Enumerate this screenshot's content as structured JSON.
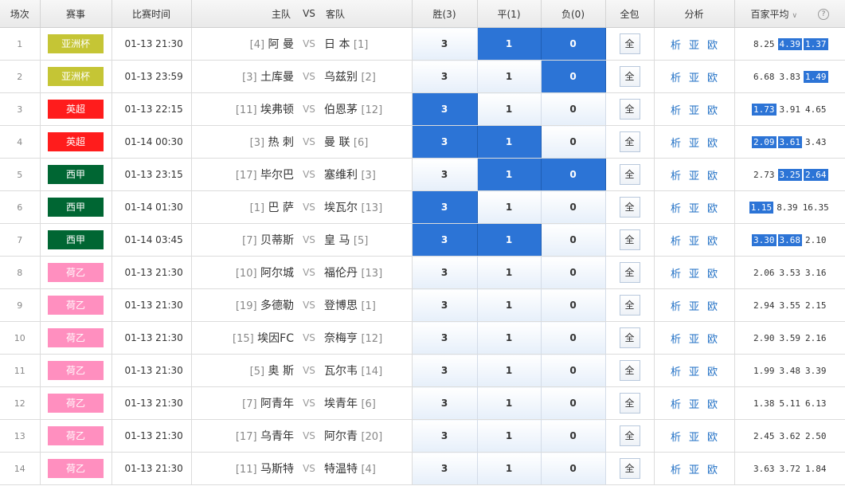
{
  "header": {
    "no": "场次",
    "league": "赛事",
    "time": "比赛时间",
    "home": "主队",
    "vs": "VS",
    "away": "客队",
    "win": "胜(3)",
    "draw": "平(1)",
    "lose": "负(0)",
    "allpack": "全包",
    "analysis": "分析",
    "avg": "百家平均"
  },
  "colors": {
    "亚洲杯": "#c5c535",
    "英超": "#ff1c1c",
    "西甲": "#006633",
    "荷乙": "#ff8fbf"
  },
  "rows": [
    {
      "no": "1",
      "league": "亚洲杯",
      "time": "01-13 21:30",
      "home_rank": "[4]",
      "home": "阿 曼",
      "vs": "VS",
      "away": "日 本",
      "away_rank": "[1]",
      "w": "3",
      "d": "1",
      "l": "0",
      "sel": [
        false,
        true,
        true
      ],
      "all": "全",
      "a1": "析",
      "a2": "亚",
      "a3": "欧",
      "odds": [
        "8.25",
        "4.39",
        "1.37"
      ],
      "hl": [
        false,
        true,
        true
      ]
    },
    {
      "no": "2",
      "league": "亚洲杯",
      "time": "01-13 23:59",
      "home_rank": "[3]",
      "home": "土库曼",
      "vs": "VS",
      "away": "乌兹别",
      "away_rank": "[2]",
      "w": "3",
      "d": "1",
      "l": "0",
      "sel": [
        false,
        false,
        true
      ],
      "all": "全",
      "a1": "析",
      "a2": "亚",
      "a3": "欧",
      "odds": [
        "6.68",
        "3.83",
        "1.49"
      ],
      "hl": [
        false,
        false,
        true
      ]
    },
    {
      "no": "3",
      "league": "英超",
      "time": "01-13 22:15",
      "home_rank": "[11]",
      "home": "埃弗顿",
      "vs": "VS",
      "away": "伯恩茅",
      "away_rank": "[12]",
      "w": "3",
      "d": "1",
      "l": "0",
      "sel": [
        true,
        false,
        false
      ],
      "all": "全",
      "a1": "析",
      "a2": "亚",
      "a3": "欧",
      "odds": [
        "1.73",
        "3.91",
        "4.65"
      ],
      "hl": [
        true,
        false,
        false
      ]
    },
    {
      "no": "4",
      "league": "英超",
      "time": "01-14 00:30",
      "home_rank": "[3]",
      "home": "热 刺",
      "vs": "VS",
      "away": "曼 联",
      "away_rank": "[6]",
      "w": "3",
      "d": "1",
      "l": "0",
      "sel": [
        true,
        true,
        false
      ],
      "all": "全",
      "a1": "析",
      "a2": "亚",
      "a3": "欧",
      "odds": [
        "2.09",
        "3.61",
        "3.43"
      ],
      "hl": [
        true,
        true,
        false
      ]
    },
    {
      "no": "5",
      "league": "西甲",
      "time": "01-13 23:15",
      "home_rank": "[17]",
      "home": "毕尔巴",
      "vs": "VS",
      "away": "塞维利",
      "away_rank": "[3]",
      "w": "3",
      "d": "1",
      "l": "0",
      "sel": [
        false,
        true,
        true
      ],
      "all": "全",
      "a1": "析",
      "a2": "亚",
      "a3": "欧",
      "odds": [
        "2.73",
        "3.25",
        "2.64"
      ],
      "hl": [
        false,
        true,
        true
      ]
    },
    {
      "no": "6",
      "league": "西甲",
      "time": "01-14 01:30",
      "home_rank": "[1]",
      "home": "巴 萨",
      "vs": "VS",
      "away": "埃瓦尔",
      "away_rank": "[13]",
      "w": "3",
      "d": "1",
      "l": "0",
      "sel": [
        true,
        false,
        false
      ],
      "all": "全",
      "a1": "析",
      "a2": "亚",
      "a3": "欧",
      "odds": [
        "1.15",
        "8.39",
        "16.35"
      ],
      "hl": [
        true,
        false,
        false
      ]
    },
    {
      "no": "7",
      "league": "西甲",
      "time": "01-14 03:45",
      "home_rank": "[7]",
      "home": "贝蒂斯",
      "vs": "VS",
      "away": "皇 马",
      "away_rank": "[5]",
      "w": "3",
      "d": "1",
      "l": "0",
      "sel": [
        true,
        true,
        false
      ],
      "all": "全",
      "a1": "析",
      "a2": "亚",
      "a3": "欧",
      "odds": [
        "3.30",
        "3.68",
        "2.10"
      ],
      "hl": [
        true,
        true,
        false
      ]
    },
    {
      "no": "8",
      "league": "荷乙",
      "time": "01-13 21:30",
      "home_rank": "[10]",
      "home": "阿尔城",
      "vs": "VS",
      "away": "福伦丹",
      "away_rank": "[13]",
      "w": "3",
      "d": "1",
      "l": "0",
      "sel": [
        false,
        false,
        false
      ],
      "all": "全",
      "a1": "析",
      "a2": "亚",
      "a3": "欧",
      "odds": [
        "2.06",
        "3.53",
        "3.16"
      ],
      "hl": [
        false,
        false,
        false
      ]
    },
    {
      "no": "9",
      "league": "荷乙",
      "time": "01-13 21:30",
      "home_rank": "[19]",
      "home": "多德勒",
      "vs": "VS",
      "away": "登博思",
      "away_rank": "[1]",
      "w": "3",
      "d": "1",
      "l": "0",
      "sel": [
        false,
        false,
        false
      ],
      "all": "全",
      "a1": "析",
      "a2": "亚",
      "a3": "欧",
      "odds": [
        "2.94",
        "3.55",
        "2.15"
      ],
      "hl": [
        false,
        false,
        false
      ]
    },
    {
      "no": "10",
      "league": "荷乙",
      "time": "01-13 21:30",
      "home_rank": "[15]",
      "home": "埃因FC",
      "vs": "VS",
      "away": "奈梅亨",
      "away_rank": "[12]",
      "w": "3",
      "d": "1",
      "l": "0",
      "sel": [
        false,
        false,
        false
      ],
      "all": "全",
      "a1": "析",
      "a2": "亚",
      "a3": "欧",
      "odds": [
        "2.90",
        "3.59",
        "2.16"
      ],
      "hl": [
        false,
        false,
        false
      ]
    },
    {
      "no": "11",
      "league": "荷乙",
      "time": "01-13 21:30",
      "home_rank": "[5]",
      "home": "奥 斯",
      "vs": "VS",
      "away": "瓦尔韦",
      "away_rank": "[14]",
      "w": "3",
      "d": "1",
      "l": "0",
      "sel": [
        false,
        false,
        false
      ],
      "all": "全",
      "a1": "析",
      "a2": "亚",
      "a3": "欧",
      "odds": [
        "1.99",
        "3.48",
        "3.39"
      ],
      "hl": [
        false,
        false,
        false
      ]
    },
    {
      "no": "12",
      "league": "荷乙",
      "time": "01-13 21:30",
      "home_rank": "[7]",
      "home": "阿青年",
      "vs": "VS",
      "away": "埃青年",
      "away_rank": "[6]",
      "w": "3",
      "d": "1",
      "l": "0",
      "sel": [
        false,
        false,
        false
      ],
      "all": "全",
      "a1": "析",
      "a2": "亚",
      "a3": "欧",
      "odds": [
        "1.38",
        "5.11",
        "6.13"
      ],
      "hl": [
        false,
        false,
        false
      ]
    },
    {
      "no": "13",
      "league": "荷乙",
      "time": "01-13 21:30",
      "home_rank": "[17]",
      "home": "乌青年",
      "vs": "VS",
      "away": "阿尔青",
      "away_rank": "[20]",
      "w": "3",
      "d": "1",
      "l": "0",
      "sel": [
        false,
        false,
        false
      ],
      "all": "全",
      "a1": "析",
      "a2": "亚",
      "a3": "欧",
      "odds": [
        "2.45",
        "3.62",
        "2.50"
      ],
      "hl": [
        false,
        false,
        false
      ]
    },
    {
      "no": "14",
      "league": "荷乙",
      "time": "01-13 21:30",
      "home_rank": "[11]",
      "home": "马斯特",
      "vs": "VS",
      "away": "特温特",
      "away_rank": "[4]",
      "w": "3",
      "d": "1",
      "l": "0",
      "sel": [
        false,
        false,
        false
      ],
      "all": "全",
      "a1": "析",
      "a2": "亚",
      "a3": "欧",
      "odds": [
        "3.63",
        "3.72",
        "1.84"
      ],
      "hl": [
        false,
        false,
        false
      ]
    }
  ]
}
